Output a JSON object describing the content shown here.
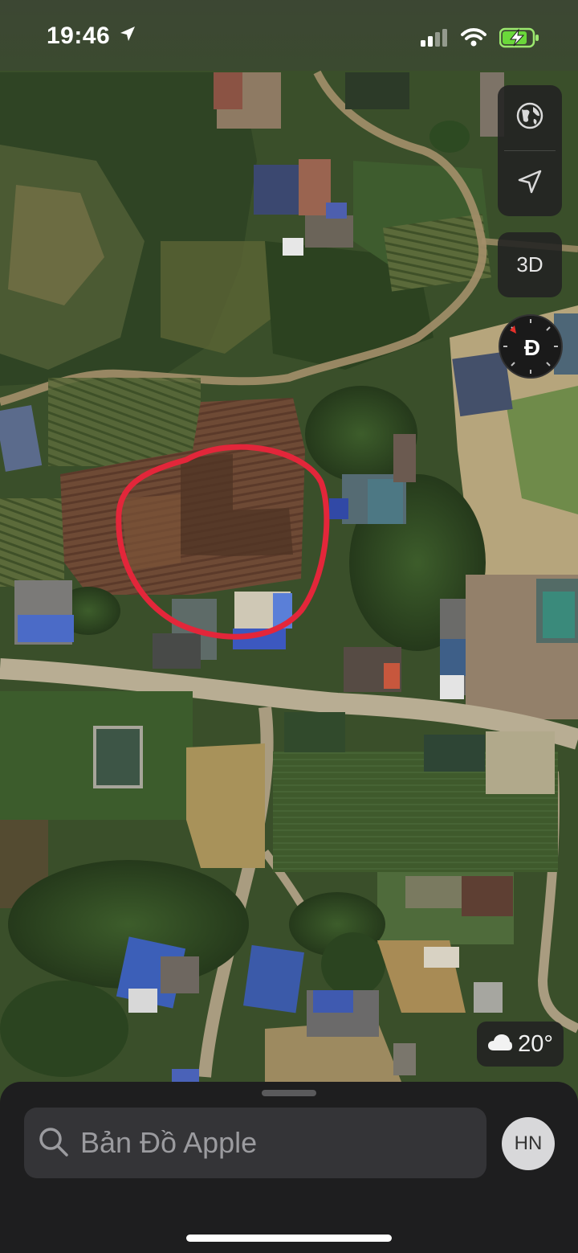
{
  "status_bar": {
    "time": "19:46",
    "icons": [
      "location-arrow-icon",
      "signal-icon",
      "wifi-icon",
      "battery-charging-icon"
    ]
  },
  "map": {
    "view": "satellite",
    "annotation": "red hand-drawn circle",
    "controls": {
      "globe_icon": "globe-icon",
      "location_icon": "location-arrow-icon",
      "view_3d_label": "3D"
    },
    "compass_letter": "Đ"
  },
  "weather": {
    "icon": "cloud-icon",
    "temperature": "20°"
  },
  "bottom_sheet": {
    "search_placeholder": "Bản Đồ Apple",
    "avatar_initials": "HN"
  },
  "colors": {
    "annotation": "#e3263a",
    "sheet_bg": "#1e1e1f",
    "search_bg": "#343437"
  }
}
